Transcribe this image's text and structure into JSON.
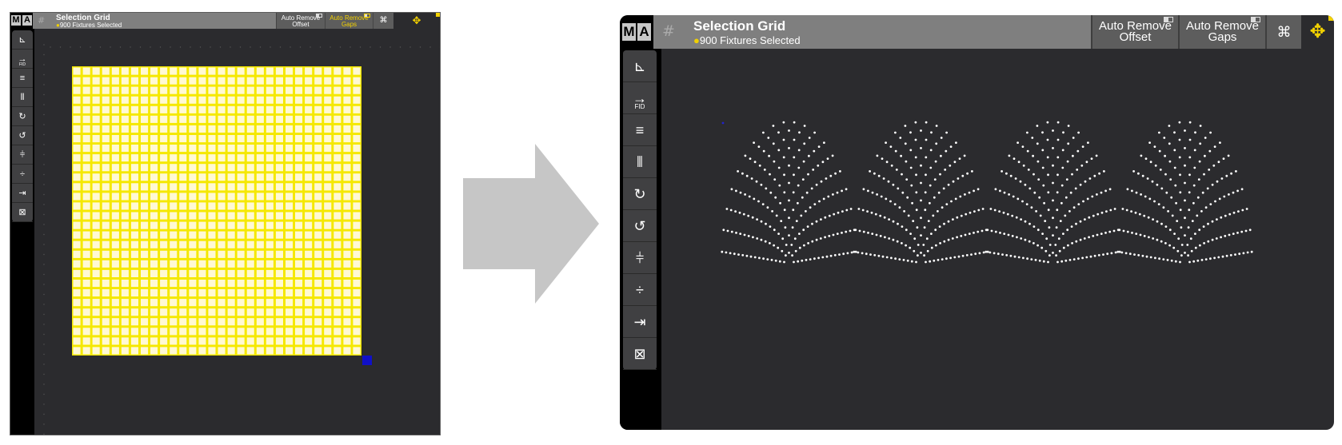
{
  "window": {
    "title": "Selection Grid",
    "subtitle": "900 Fixtures Selected",
    "logo_left": "M",
    "logo_right": "A",
    "grid_icon": "grid-icon",
    "buttons": {
      "auto_remove_offset": {
        "line1": "Auto Remove",
        "line2": "Offset"
      },
      "auto_remove_gaps": {
        "line1": "Auto Remove",
        "line2": "Gaps"
      }
    },
    "icons": {
      "visibility": "eye-grid-icon",
      "move": "move-arrows-icon"
    }
  },
  "sidebar": {
    "tools": [
      {
        "icon": "align-corner-icon"
      },
      {
        "icon": "fid-arrow-icon",
        "label": "FID"
      },
      {
        "icon": "horizontal-lines-arrow-icon"
      },
      {
        "icon": "vertical-lines-arrow-icon"
      },
      {
        "icon": "rotate-clockwise-icon"
      },
      {
        "icon": "rotate-counterclockwise-icon"
      },
      {
        "icon": "mirror-horizontal-icon"
      },
      {
        "icon": "mirror-vertical-icon"
      },
      {
        "icon": "collapse-horizontal-icon"
      },
      {
        "icon": "fit-to-frame-icon"
      }
    ]
  },
  "before": {
    "grid_rows": 30,
    "grid_cols": 30,
    "selection_color": "#f5e800"
  },
  "after": {
    "dot_color": "#ffffff",
    "arc_count": 4
  },
  "colors": {
    "accent": "#f3d100",
    "titlebar": "#7f7f7f",
    "button": "#5d5d5d",
    "background": "#2b2b2e",
    "arrow": "#c6c6c6"
  }
}
